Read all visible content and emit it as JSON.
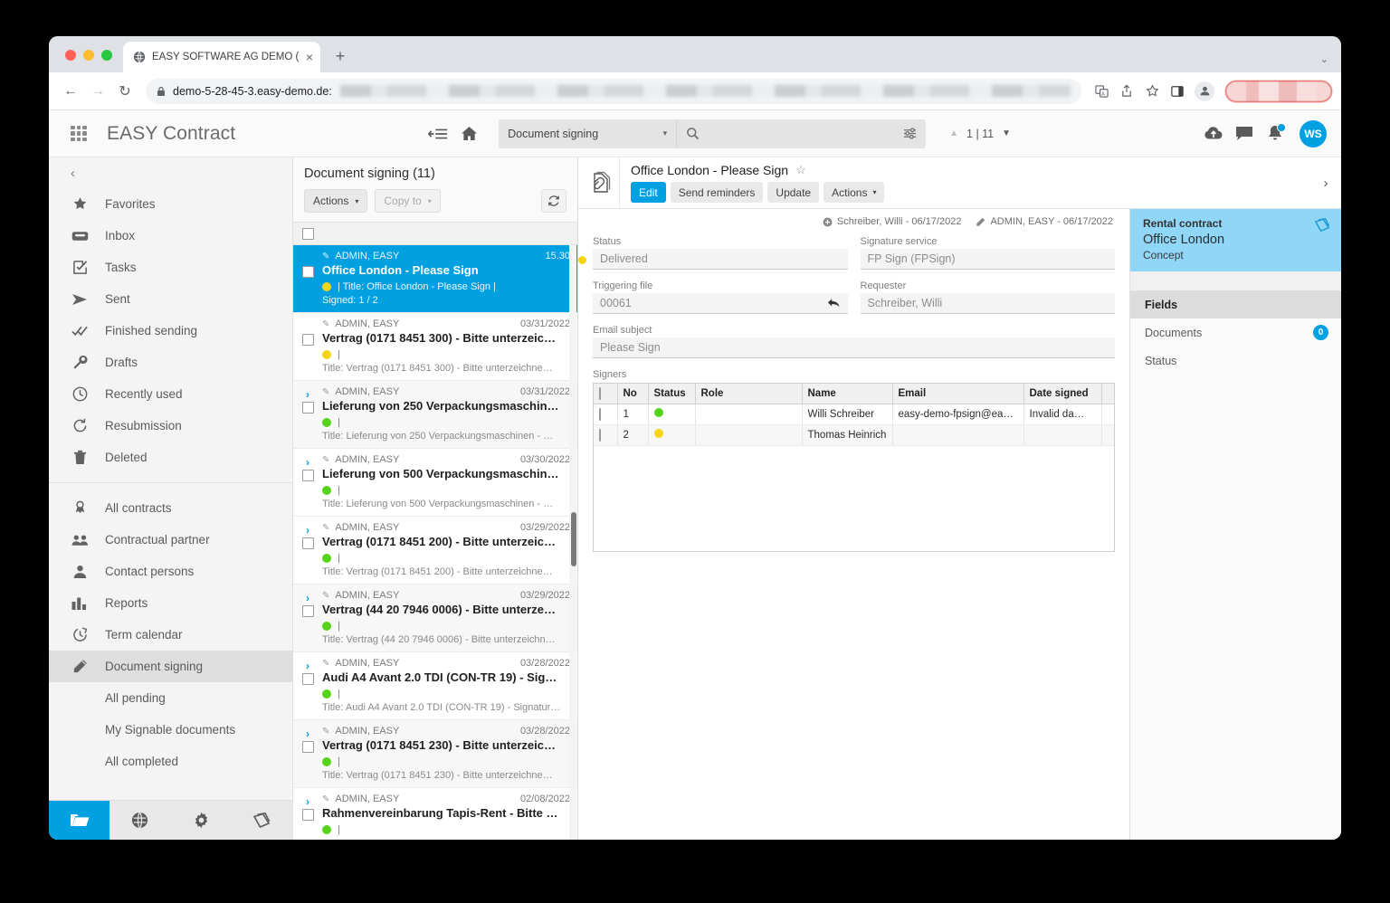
{
  "browser": {
    "tab_title": "EASY SOFTWARE AG DEMO (C",
    "tab_close": "×",
    "new_tab": "+",
    "window_chevron": "⌄",
    "back": "←",
    "forward": "→",
    "reload": "↻",
    "lock_glyph": "🔒",
    "url": "demo-5-28-45-3.easy-demo.de:"
  },
  "app": {
    "title": "EASY Contract",
    "search": {
      "scope": "Document signing",
      "scope_caret": "▾",
      "placeholder": "",
      "value": ""
    },
    "pager": {
      "up": "▲",
      "down": "▼",
      "count": "1 | 11"
    },
    "avatar": "WS"
  },
  "sidebar": {
    "collapse": "‹",
    "items": [
      {
        "label": "Favorites",
        "icon": "star-icon"
      },
      {
        "label": "Inbox",
        "icon": "inbox-icon"
      },
      {
        "label": "Tasks",
        "icon": "tasks-icon"
      },
      {
        "label": "Sent",
        "icon": "sent-icon"
      },
      {
        "label": "Finished sending",
        "icon": "double-check-icon"
      },
      {
        "label": "Drafts",
        "icon": "wrench-icon"
      },
      {
        "label": "Recently used",
        "icon": "clock-icon"
      },
      {
        "label": "Resubmission",
        "icon": "refresh-icon"
      },
      {
        "label": "Deleted",
        "icon": "trash-icon"
      }
    ],
    "items2": [
      {
        "label": "All contracts",
        "icon": "contract-icon"
      },
      {
        "label": "Contractual partner",
        "icon": "group-icon"
      },
      {
        "label": "Contact persons",
        "icon": "person-icon"
      },
      {
        "label": "Reports",
        "icon": "bar-chart-icon"
      },
      {
        "label": "Term calendar",
        "icon": "term-calendar-icon"
      },
      {
        "label": "Document signing",
        "icon": "pencil-icon",
        "active": true
      }
    ],
    "subitems": [
      "All pending",
      "My Signable documents",
      "All completed"
    ],
    "bottom": [
      {
        "icon": "folder-icon",
        "active": true
      },
      {
        "icon": "globe-icon",
        "active": false
      },
      {
        "icon": "gear-icon",
        "active": false
      },
      {
        "icon": "copy-icon",
        "active": false
      }
    ]
  },
  "list": {
    "title": "Document signing (11)",
    "actions_label": "Actions",
    "copy_to_label": "Copy to",
    "refresh_icon": "refresh-icon",
    "items": [
      {
        "author": "ADMIN, EASY",
        "date": "15.30",
        "title": "Office London - Please Sign",
        "status": "yellow",
        "meta": "| Title: Office London - Please Sign  |",
        "sub": "Signed: 1 / 2",
        "selected": true,
        "expandable": false
      },
      {
        "author": "ADMIN, EASY",
        "date": "03/31/2022",
        "title": "Vertrag (0171 8451 300) - Bitte unterzeic…",
        "status": "yellow",
        "meta": "|",
        "sub": "Title: Vertrag (0171 8451 300) - Bitte unterzeichne…",
        "selected": false,
        "expandable": false
      },
      {
        "author": "ADMIN, EASY",
        "date": "03/31/2022",
        "title": "Lieferung von 250 Verpackungsmaschin…",
        "status": "green",
        "meta": "|",
        "sub": "Title: Lieferung von 250 Verpackungsmaschinen - …",
        "selected": false,
        "expandable": true
      },
      {
        "author": "ADMIN, EASY",
        "date": "03/30/2022",
        "title": "Lieferung von 500 Verpackungsmaschin…",
        "status": "green",
        "meta": "|",
        "sub": "Title: Lieferung von 500 Verpackungsmaschinen - …",
        "selected": false,
        "expandable": true
      },
      {
        "author": "ADMIN, EASY",
        "date": "03/29/2022",
        "title": "Vertrag (0171 8451 200) - Bitte unterzeic…",
        "status": "green",
        "meta": "|",
        "sub": "Title: Vertrag (0171 8451 200) - Bitte unterzeichne…",
        "selected": false,
        "expandable": true
      },
      {
        "author": "ADMIN, EASY",
        "date": "03/29/2022",
        "title": "Vertrag (44 20 7946 0006) - Bitte unterze…",
        "status": "green",
        "meta": "|",
        "sub": "Title: Vertrag (44 20 7946 0006) - Bitte unterzeichn…",
        "selected": false,
        "expandable": true
      },
      {
        "author": "ADMIN, EASY",
        "date": "03/28/2022",
        "title": "Audi A4 Avant 2.0 TDI (CON-TR 19) - Sig…",
        "status": "green",
        "meta": "|",
        "sub": "Title: Audi A4 Avant 2.0 TDI (CON-TR 19) - Signatur…",
        "selected": false,
        "expandable": true
      },
      {
        "author": "ADMIN, EASY",
        "date": "03/28/2022",
        "title": "Vertrag (0171 8451 230) - Bitte unterzeic…",
        "status": "green",
        "meta": "|",
        "sub": "Title: Vertrag (0171 8451 230) - Bitte unterzeichne…",
        "selected": false,
        "expandable": true
      },
      {
        "author": "ADMIN, EASY",
        "date": "02/08/2022",
        "title": "Rahmenvereinbarung Tapis-Rent - Bitte …",
        "status": "green",
        "meta": "|",
        "sub": "",
        "selected": false,
        "expandable": true
      }
    ]
  },
  "detail": {
    "icon": "document-attachment-icon",
    "title": "Office London - Please Sign",
    "star": "☆",
    "buttons": [
      {
        "label": "Edit",
        "primary": true
      },
      {
        "label": "Send reminders",
        "primary": false
      },
      {
        "label": "Update",
        "primary": false
      },
      {
        "label": "Actions",
        "primary": false,
        "caret": true
      }
    ],
    "next_chevron": "›",
    "meta_created": "Schreiber, Willi - 06/17/2022",
    "meta_modified": "ADMIN, EASY - 06/17/2022",
    "fields": {
      "status_label": "Status",
      "status_value": "Delivered",
      "signature_service_label": "Signature service",
      "signature_service_value": "FP Sign (FPSign)",
      "triggering_file_label": "Triggering file",
      "triggering_file_value": "00061",
      "requester_label": "Requester",
      "requester_value": "Schreiber, Willi",
      "email_subject_label": "Email subject",
      "email_subject_value": "Please Sign"
    },
    "signers": {
      "label": "Signers",
      "columns": [
        "No",
        "Status",
        "Role",
        "Name",
        "Email",
        "Date signed"
      ],
      "rows": [
        {
          "no": "1",
          "status": "green",
          "role": "",
          "name": "Willi Schreiber",
          "email": "easy-demo-fpsign@ea…",
          "email_blurred": false,
          "date_signed": "Invalid da…",
          "date_blurred": false
        },
        {
          "no": "2",
          "status": "yellow",
          "role": "",
          "name": "Thomas Heinrich",
          "email": "",
          "email_blurred": true,
          "date_signed": "",
          "date_blurred": false
        }
      ]
    }
  },
  "rail": {
    "card": {
      "kind": "Rental contract",
      "name": "Office London",
      "state": "Concept",
      "icon": "copy-icon"
    },
    "section": "Fields",
    "items": [
      {
        "label": "Documents",
        "badge": "0"
      },
      {
        "label": "Status",
        "badge": ""
      }
    ]
  },
  "colors": {
    "accent": "#00a0e1",
    "status_green": "#56d41b",
    "status_yellow": "#f5d518",
    "rail_card": "#8fd6f7"
  }
}
